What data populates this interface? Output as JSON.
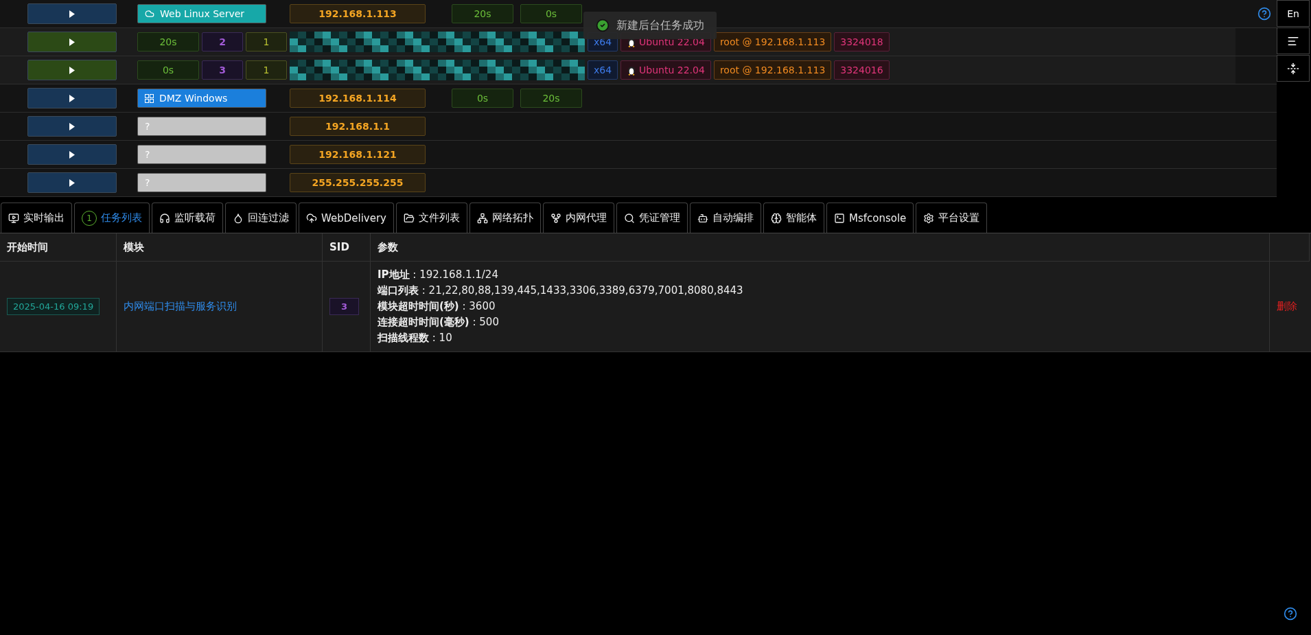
{
  "hosts": [
    {
      "kind": "linux",
      "name": "Web Linux Server",
      "ip": "192.168.1.113",
      "timers": [
        "20s",
        "0s"
      ]
    },
    {
      "kind": "session",
      "heartbeat": "20s",
      "session_id": "2",
      "count": "1",
      "arch": "x64",
      "os": "Ubuntu 22.04",
      "user_host": "root @ 192.168.1.113",
      "pid": "3324018"
    },
    {
      "kind": "session",
      "heartbeat": "0s",
      "session_id": "3",
      "count": "1",
      "arch": "x64",
      "os": "Ubuntu 22.04",
      "user_host": "root @ 192.168.1.113",
      "pid": "3324016"
    },
    {
      "kind": "windows",
      "name": "DMZ Windows",
      "ip": "192.168.1.114",
      "timers": [
        "0s",
        "20s"
      ]
    },
    {
      "kind": "unknown",
      "name": "?",
      "ip": "192.168.1.1"
    },
    {
      "kind": "unknown",
      "name": "?",
      "ip": "192.168.1.121"
    },
    {
      "kind": "unknown",
      "name": "?",
      "ip": "255.255.255.255"
    }
  ],
  "toast": "新建后台任务成功",
  "side_buttons": [
    "En"
  ],
  "tabs": [
    {
      "label": "实时输出",
      "selected": false
    },
    {
      "label": "任务列表",
      "selected": true,
      "badge": "1"
    },
    {
      "label": "监听载荷",
      "selected": false
    },
    {
      "label": "回连过滤",
      "selected": false
    },
    {
      "label": "WebDelivery",
      "selected": false
    },
    {
      "label": "文件列表",
      "selected": false
    },
    {
      "label": "网络拓扑",
      "selected": false
    },
    {
      "label": "内网代理",
      "selected": false
    },
    {
      "label": "凭证管理",
      "selected": false
    },
    {
      "label": "自动编排",
      "selected": false
    },
    {
      "label": "智能体",
      "selected": false
    },
    {
      "label": "Msfconsole",
      "selected": false
    },
    {
      "label": "平台设置",
      "selected": false
    }
  ],
  "table": {
    "columns": [
      "开始时间",
      "模块",
      "SID",
      "参数"
    ],
    "rows": [
      {
        "start_time": "2025-04-16 09:19",
        "module": "内网端口扫描与服务识别",
        "sid": "3",
        "params": [
          "**IP地址** : 192.168.1.1/24",
          "**端口列表** : 21,22,80,88,139,445,1433,3306,3389,6379,7001,8080,8443",
          "**模块超时时间(秒)** : 3600",
          "**连接超时时间(毫秒)** : 500",
          "**扫描线程数** : 10"
        ],
        "action": "删除"
      }
    ]
  }
}
